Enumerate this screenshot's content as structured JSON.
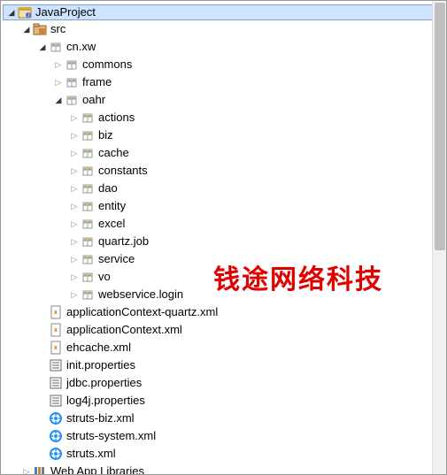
{
  "watermark": "钱途网络科技",
  "tree": [
    {
      "depth": 0,
      "arrow": "down",
      "icon": "java-project",
      "label": "JavaProject",
      "selected": true
    },
    {
      "depth": 1,
      "arrow": "down",
      "icon": "src-folder",
      "label": "src"
    },
    {
      "depth": 2,
      "arrow": "down",
      "icon": "package",
      "label": "cn.xw"
    },
    {
      "depth": 3,
      "arrow": "right",
      "icon": "package",
      "label": "commons"
    },
    {
      "depth": 3,
      "arrow": "right",
      "icon": "package",
      "label": "frame"
    },
    {
      "depth": 3,
      "arrow": "down",
      "icon": "package",
      "label": "oahr"
    },
    {
      "depth": 4,
      "arrow": "right",
      "icon": "package",
      "label": "actions"
    },
    {
      "depth": 4,
      "arrow": "right",
      "icon": "package",
      "label": "biz"
    },
    {
      "depth": 4,
      "arrow": "right",
      "icon": "package",
      "label": "cache"
    },
    {
      "depth": 4,
      "arrow": "right",
      "icon": "package",
      "label": "constants"
    },
    {
      "depth": 4,
      "arrow": "right",
      "icon": "package",
      "label": "dao"
    },
    {
      "depth": 4,
      "arrow": "right",
      "icon": "package",
      "label": "entity"
    },
    {
      "depth": 4,
      "arrow": "right",
      "icon": "package",
      "label": "excel"
    },
    {
      "depth": 4,
      "arrow": "right",
      "icon": "package",
      "label": "quartz.job"
    },
    {
      "depth": 4,
      "arrow": "right",
      "icon": "package",
      "label": "service"
    },
    {
      "depth": 4,
      "arrow": "right",
      "icon": "package",
      "label": "vo"
    },
    {
      "depth": 4,
      "arrow": "right",
      "icon": "package",
      "label": "webservice.login"
    },
    {
      "depth": 2,
      "arrow": "none",
      "icon": "xml-file",
      "label": "applicationContext-quartz.xml"
    },
    {
      "depth": 2,
      "arrow": "none",
      "icon": "xml-file",
      "label": "applicationContext.xml"
    },
    {
      "depth": 2,
      "arrow": "none",
      "icon": "xml-file",
      "label": "ehcache.xml"
    },
    {
      "depth": 2,
      "arrow": "none",
      "icon": "properties-file",
      "label": "init.properties"
    },
    {
      "depth": 2,
      "arrow": "none",
      "icon": "properties-file",
      "label": "jdbc.properties"
    },
    {
      "depth": 2,
      "arrow": "none",
      "icon": "properties-file",
      "label": "log4j.properties"
    },
    {
      "depth": 2,
      "arrow": "none",
      "icon": "struts-file",
      "label": "struts-biz.xml"
    },
    {
      "depth": 2,
      "arrow": "none",
      "icon": "struts-file",
      "label": "struts-system.xml"
    },
    {
      "depth": 2,
      "arrow": "none",
      "icon": "struts-file",
      "label": "struts.xml"
    },
    {
      "depth": 1,
      "arrow": "right",
      "icon": "library",
      "label": "Web App Libraries"
    }
  ]
}
